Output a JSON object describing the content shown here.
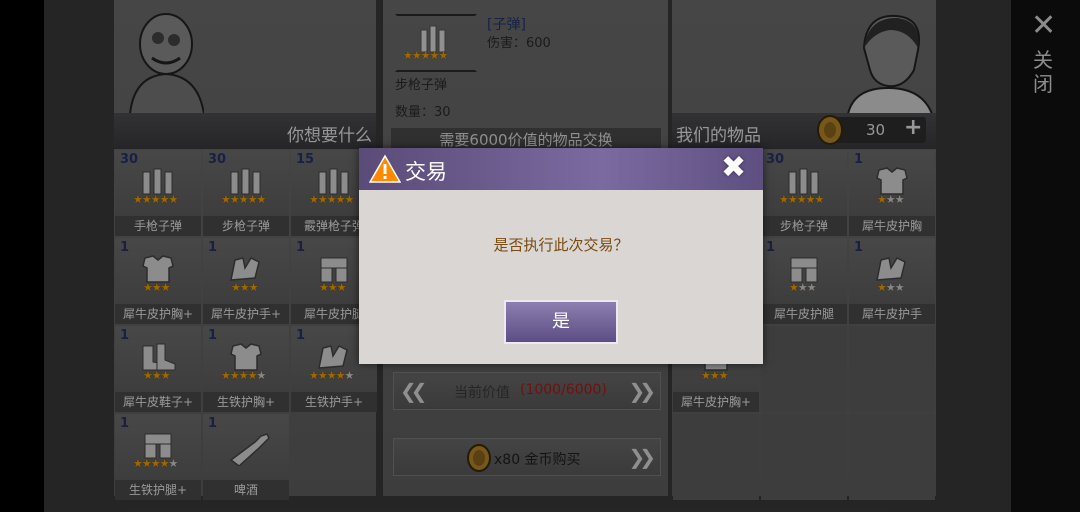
{
  "close": {
    "icon": "close-icon",
    "label": "关闭"
  },
  "left_panel": {
    "header": "你想要什么",
    "items": [
      {
        "count": "30",
        "label": "手枪子弹",
        "icon": "pistol-ammo-icon",
        "stars": 5
      },
      {
        "count": "30",
        "label": "步枪子弹",
        "icon": "rifle-ammo-icon",
        "stars": 5
      },
      {
        "count": "15",
        "label": "霰弹枪子弹",
        "icon": "shotgun-ammo-icon",
        "stars": 5
      },
      {
        "count": "1",
        "label": "犀牛皮护胸+",
        "icon": "armor-vest-icon",
        "stars": 3
      },
      {
        "count": "1",
        "label": "犀牛皮护手+",
        "icon": "gloves-icon",
        "stars": 3
      },
      {
        "count": "1",
        "label": "犀牛皮护腿",
        "icon": "leg-armor-icon",
        "stars": 3
      },
      {
        "count": "1",
        "label": "犀牛皮鞋子+",
        "icon": "boots-icon",
        "stars": 3
      },
      {
        "count": "1",
        "label": "生铁护胸+",
        "icon": "iron-vest-icon",
        "stars": 4
      },
      {
        "count": "1",
        "label": "生铁护手+",
        "icon": "iron-gloves-icon",
        "stars": 4
      },
      {
        "count": "1",
        "label": "生铁护腿+",
        "icon": "iron-leg-icon",
        "stars": 4
      },
      {
        "count": "1",
        "label": "啤酒",
        "icon": "beer-bottle-icon",
        "stars": 0
      }
    ]
  },
  "center_panel": {
    "item_name": "[子弹]",
    "damage_text": "伤害：600",
    "item_title": "步枪子弹",
    "quantity_text": "数量：30",
    "stars": 5,
    "exchange_note": "需要6000价值的物品交换",
    "current_value_label": "当前价值",
    "current_value": "(1000/6000)",
    "buy_label": "x80 金币购买"
  },
  "right_panel": {
    "header": "我们的物品",
    "coins": "30",
    "plus": "+",
    "items": [
      {
        "count": "30",
        "label": "步枪子弹",
        "icon": "rifle-ammo-icon",
        "stars": 5,
        "col": 1,
        "row": 0
      },
      {
        "count": "1",
        "label": "犀牛皮护胸",
        "icon": "armor-vest-icon",
        "stars": 1,
        "col": 2,
        "row": 0
      },
      {
        "count": "1",
        "label": "犀牛皮护腿",
        "icon": "leg-armor-icon",
        "stars": 1,
        "col": 1,
        "row": 1
      },
      {
        "count": "1",
        "label": "犀牛皮护手",
        "icon": "gloves-icon",
        "stars": 1,
        "col": 2,
        "row": 1
      },
      {
        "count": "",
        "label": "犀牛皮护胸+",
        "icon": "armor-vest-icon",
        "stars": 3,
        "col": 0,
        "row": 2
      }
    ]
  },
  "dialog": {
    "title": "交易",
    "message": "是否执行此次交易？",
    "confirm": "是",
    "warning_icon": "warning-icon",
    "close_icon": "close-icon"
  },
  "colors": {
    "accent": "#f2a200",
    "dialog_header": "#6b5b8f",
    "value_red": "#b01818"
  }
}
